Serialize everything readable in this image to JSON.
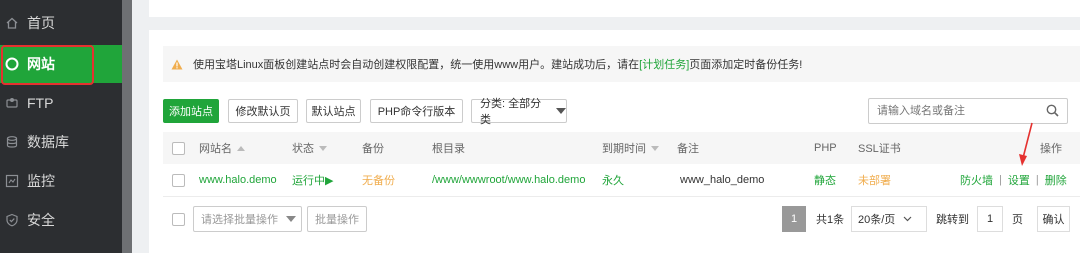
{
  "sidebar": {
    "items": [
      {
        "label": "首页",
        "icon": "home-icon"
      },
      {
        "label": "网站",
        "icon": "globe-icon"
      },
      {
        "label": "FTP",
        "icon": "ftp-icon"
      },
      {
        "label": "数据库",
        "icon": "database-icon"
      },
      {
        "label": "监控",
        "icon": "monitor-icon"
      },
      {
        "label": "安全",
        "icon": "shield-icon"
      }
    ],
    "active_label": "网站"
  },
  "notice": {
    "text_before": "使用宝塔Linux面板创建站点时会自动创建权限配置，统一使用www用户。建站成功后，请在",
    "link": "[计划任务]",
    "text_after": "页面添加定时备份任务!"
  },
  "toolbar": {
    "add_site": "添加站点",
    "edit_default_page": "修改默认页",
    "default_site": "默认站点",
    "php_cli_version": "PHP命令行版本",
    "category_select": "分类: 全部分类"
  },
  "search": {
    "placeholder": "请输入域名或备注"
  },
  "table": {
    "headers": {
      "site_name": "网站名",
      "status": "状态",
      "backup": "备份",
      "root_dir": "根目录",
      "expire": "到期时间",
      "remark": "备注",
      "php": "PHP",
      "ssl": "SSL证书",
      "actions": "操作"
    },
    "rows": [
      {
        "site_name": "www.halo.demo",
        "status": "运行中▶",
        "backup": "无备份",
        "root_dir": "/www/wwwroot/www.halo.demo",
        "expire": "永久",
        "remark": "www_halo_demo",
        "php": "静态",
        "ssl": "未部署",
        "actions": [
          "防火墙",
          "设置",
          "删除"
        ]
      }
    ]
  },
  "footer": {
    "batch_select": "请选择批量操作",
    "batch_button": "批量操作",
    "current_page": "1",
    "total": "共1条",
    "per_page": "20条/页",
    "goto_label": "跳转到",
    "goto_value": "1",
    "page_unit": "页",
    "confirm": "确认"
  },
  "colors": {
    "accent": "#20a53a",
    "warning": "#f0ad4e",
    "highlight": "#e5312f",
    "sidebar_bg": "#2c2e31"
  }
}
